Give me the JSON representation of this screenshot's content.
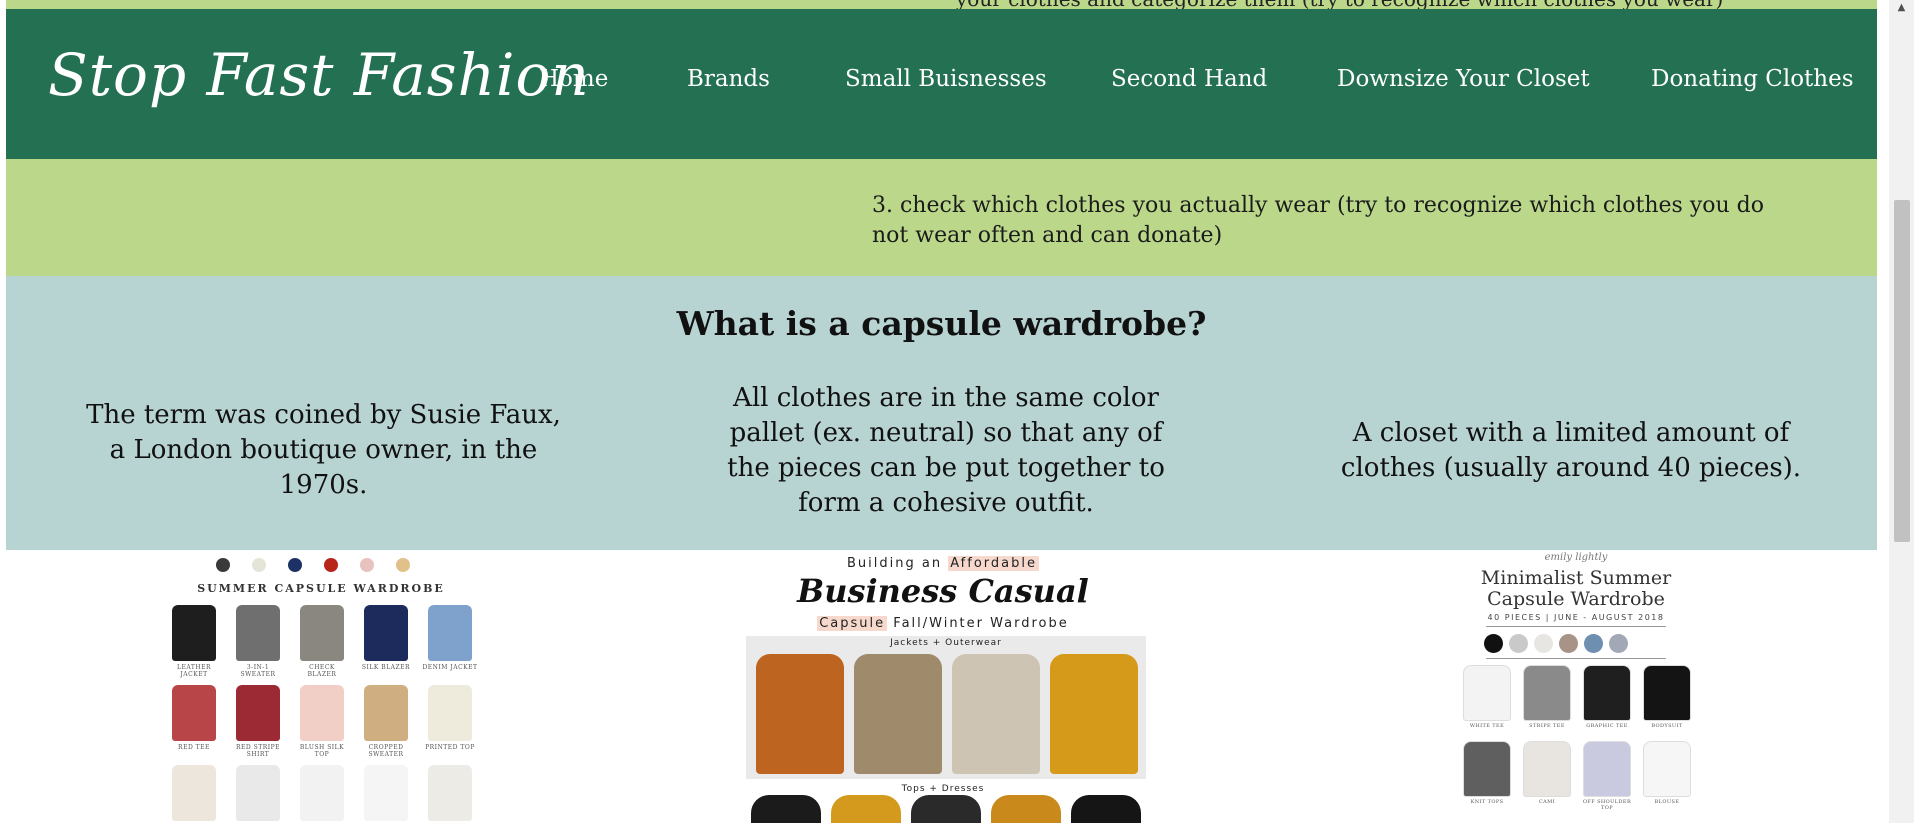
{
  "top_strip": {
    "cut_text": "your clothes and categorize them (try to recognize which clothes you wear)"
  },
  "navbar": {
    "logo": "Stop Fast Fashion",
    "items": [
      {
        "label": "Home"
      },
      {
        "label": "Brands"
      },
      {
        "label": "Small Buisnesses"
      },
      {
        "label": "Second Hand"
      },
      {
        "label": "Downsize Your Closet"
      },
      {
        "label": "Donating Clothes"
      }
    ],
    "background_color": "#237052"
  },
  "tip_section": {
    "text": "3. check which clothes you actually wear (try to recognize which clothes you do not wear often and can donate)",
    "background_color": "#bbd88a"
  },
  "capsule_section": {
    "heading": "What is a capsule wardrobe?",
    "columns": [
      {
        "text": "The term was coined by Susie Faux, a London boutique owner, in the 1970s."
      },
      {
        "text": "All clothes are in the same color pallet (ex. neutral) so that any of the pieces can be put together to form a cohesive outfit."
      },
      {
        "text": "A closet with a limited amount of clothes (usually around 40 pieces)."
      }
    ],
    "background_color": "#b7d3d2"
  },
  "images": {
    "summer_capsule": {
      "title": "SUMMER CAPSULE WARDROBE",
      "palette": [
        "#3a3a3a",
        "#e4e4d8",
        "#1d3264",
        "#b8261a",
        "#e8c2bf",
        "#e2c08a"
      ],
      "items": [
        {
          "label": "LEATHER JACKET",
          "color": "#1e1e1e"
        },
        {
          "label": "3-IN-1 SWEATER",
          "color": "#6f6f6f"
        },
        {
          "label": "CHECK BLAZER",
          "color": "#8a8680"
        },
        {
          "label": "SILK BLAZER",
          "color": "#1c2b5b"
        },
        {
          "label": "DENIM JACKET",
          "color": "#7ea2cc"
        },
        {
          "label": "RED TEE",
          "color": "#b84547"
        },
        {
          "label": "RED STRIPE SHIRT",
          "color": "#9b2a35"
        },
        {
          "label": "BLUSH SILK TOP",
          "color": "#f1cfc7"
        },
        {
          "label": "CROPPED SWEATER",
          "color": "#cfae82"
        },
        {
          "label": "PRINTED TOP",
          "color": "#eeeadc"
        },
        {
          "label": "",
          "color": "#ece6dd"
        },
        {
          "label": "",
          "color": "#e9e9e9"
        },
        {
          "label": "",
          "color": "#f2f2f2"
        },
        {
          "label": "",
          "color": "#f5f5f5"
        },
        {
          "label": "",
          "color": "#ecebe6"
        }
      ]
    },
    "business_casual": {
      "top_line_prefix": "Building an ",
      "top_line_highlight": "Affordable",
      "title": "Business Casual",
      "sub_highlight": "Capsule",
      "sub_rest": " Fall/Winter Wardrobe",
      "panel_label": "Jackets + Outerwear",
      "panel2_label": "Tops + Dresses",
      "coats": [
        {
          "name": "teddy-coat",
          "color": "#bd6520"
        },
        {
          "name": "plaid-blazer",
          "color": "#a08a6c"
        },
        {
          "name": "trench-jacket",
          "color": "#cdc4b3"
        },
        {
          "name": "mustard-cardigan",
          "color": "#d59a1a"
        }
      ],
      "tops": [
        {
          "name": "black-top",
          "color": "#1b1b1b"
        },
        {
          "name": "mustard-top",
          "color": "#d49a1e"
        },
        {
          "name": "lace-cami",
          "color": "#2a2a2a"
        },
        {
          "name": "mustard-blouse",
          "color": "#c9891b"
        },
        {
          "name": "black-tee",
          "color": "#151515"
        }
      ]
    },
    "minimalist_summer": {
      "script": "emily lightly",
      "title_line1": "Minimalist Summer",
      "title_line2": "Capsule Wardrobe",
      "subtitle": "40 PIECES | JUNE - AUGUST 2018",
      "palette": [
        "#111111",
        "#c9c9c9",
        "#e8e6e2",
        "#a89387",
        "#6f8fb0",
        "#a2a8b6"
      ],
      "items": [
        {
          "label": "WHITE TEE",
          "color": "#f3f3f3"
        },
        {
          "label": "STRIPE TEE",
          "color": "#8a8a8a"
        },
        {
          "label": "GRAPHIC TEE",
          "color": "#1f1f1f"
        },
        {
          "label": "BODYSUIT",
          "color": "#141414"
        },
        {
          "label": "KNIT TOPS",
          "color": "#5f5f5f"
        },
        {
          "label": "CAMI",
          "color": "#e8e4df"
        },
        {
          "label": "OFF SHOULDER TOP",
          "color": "#c9c9e0"
        },
        {
          "label": "BLOUSE",
          "color": "#f6f6f6"
        }
      ]
    }
  }
}
